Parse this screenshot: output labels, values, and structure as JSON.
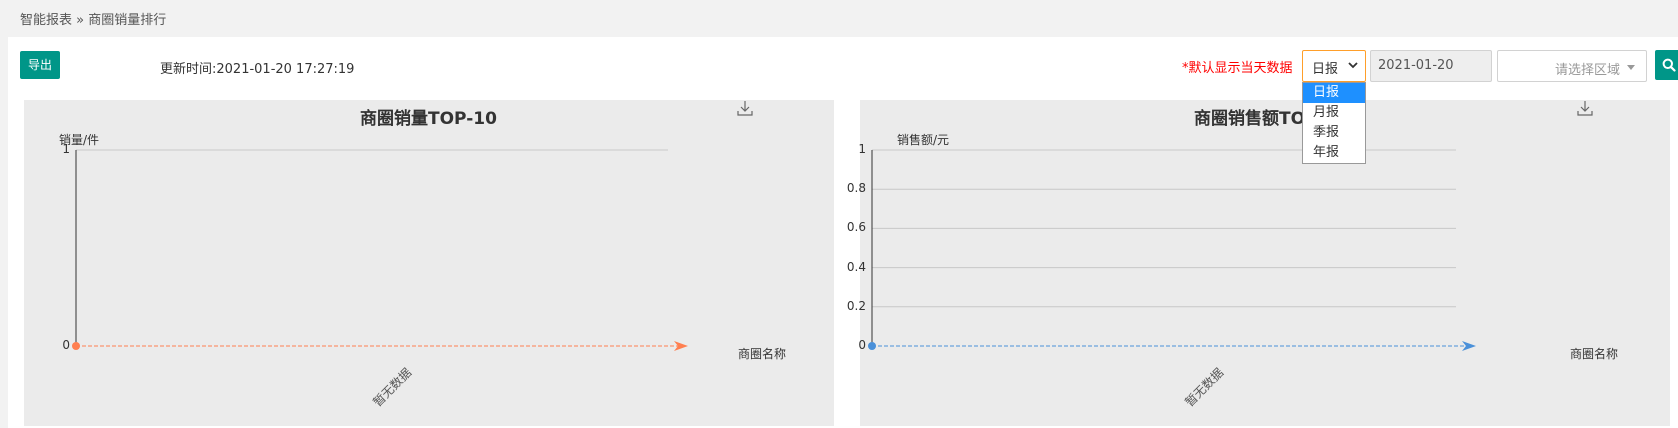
{
  "breadcrumb": {
    "root": "智能报表",
    "sep": "»",
    "current": "商圈销量排行"
  },
  "toolbar": {
    "export_label": "导出",
    "update_time": "更新时间:2021-01-20 17:27:19",
    "notice": "*默认显示当天数据",
    "period_select": {
      "value": "日报",
      "options": [
        "日报",
        "月报",
        "季报",
        "年报"
      ],
      "active_index": 0
    },
    "date_value": "2021-01-20",
    "region_placeholder": "请选择区域"
  },
  "colors": {
    "accent": "#009688",
    "notice": "#ff0000",
    "select_border": "#ff9f2a",
    "dropdown_active": "#1e90ff",
    "series1": "#ff7f50",
    "series2": "#4a90d9"
  },
  "icons": {
    "search": "search-icon",
    "download": "download-icon",
    "chevron": "chevron-down-icon"
  },
  "chart_data": [
    {
      "type": "line",
      "title": "商圈销量TOP-10",
      "ylabel": "销量/件",
      "xlabel": "商圈名称",
      "categories": [
        "暂无数据"
      ],
      "values": [
        0
      ],
      "ylim": [
        0,
        1
      ],
      "yticks": [
        "0",
        "1"
      ],
      "grid": true
    },
    {
      "type": "line",
      "title": "商圈销售额TO",
      "ylabel": "销售额/元",
      "xlabel": "商圈名称",
      "categories": [
        "暂无数据"
      ],
      "values": [
        0
      ],
      "ylim": [
        0,
        1
      ],
      "yticks": [
        "0",
        "0.2",
        "0.4",
        "0.6",
        "0.8",
        "1"
      ],
      "grid": true
    }
  ]
}
